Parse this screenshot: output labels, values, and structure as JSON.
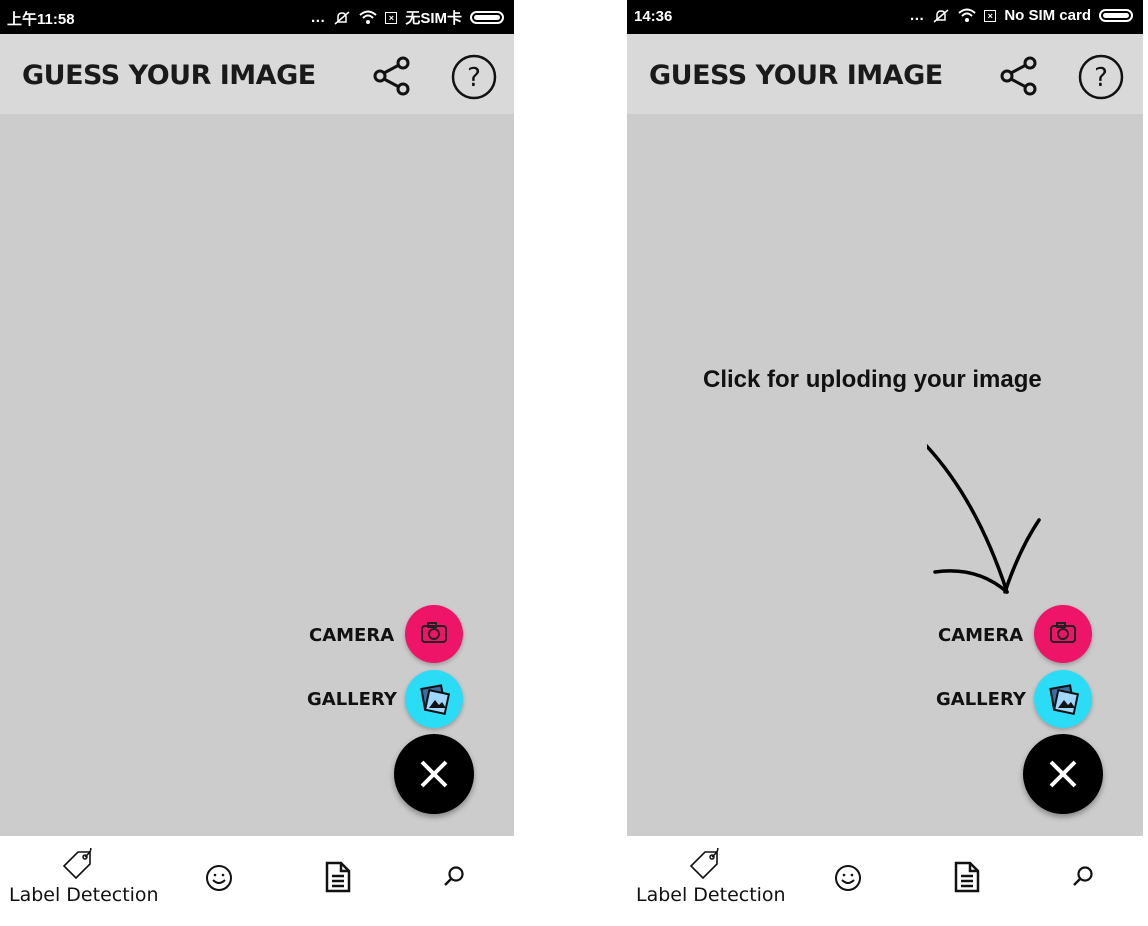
{
  "screens": [
    {
      "status_time": "上午11:58",
      "status_right": "无SIM卡",
      "app_title": "GUESS YOUR IMAGE",
      "hint": "",
      "camera_label": "CAMERA",
      "gallery_label": "GALLERY",
      "nav_label": "Label Detection"
    },
    {
      "status_time": "14:36",
      "status_right": "No SIM card",
      "app_title": "GUESS YOUR IMAGE",
      "hint": "Click for uploding your image",
      "camera_label": "CAMERA",
      "gallery_label": "GALLERY",
      "nav_label": "Label Detection"
    }
  ],
  "icons": {
    "share": "share-icon",
    "help": "help-icon",
    "camera": "camera-icon",
    "gallery": "gallery-icon",
    "close": "close-icon",
    "label": "tag-icon",
    "face": "face-icon",
    "document": "document-icon",
    "search": "search-icon"
  },
  "colors": {
    "camera_fab": "#ee1467",
    "gallery_fab": "#2bdcf6",
    "main_fab": "#000000",
    "appbar": "#d9d9d9",
    "content": "#cccccc"
  }
}
